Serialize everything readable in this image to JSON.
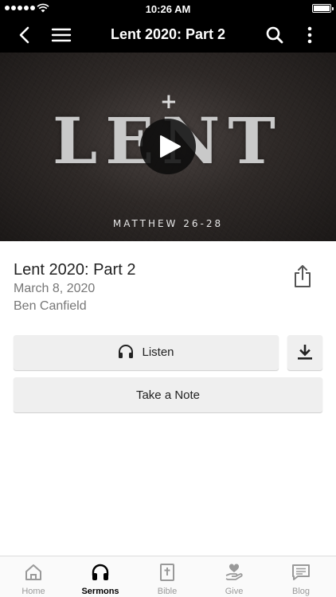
{
  "status_bar": {
    "time": "10:26 AM"
  },
  "nav": {
    "title": "Lent 2020: Part 2"
  },
  "hero": {
    "cross": "+",
    "word": "LENT",
    "subtitle": "MATTHEW 26-28"
  },
  "sermon": {
    "title": "Lent 2020: Part 2",
    "date": "March 8, 2020",
    "speaker": "Ben Canfield"
  },
  "actions": {
    "listen_label": "Listen",
    "note_label": "Take a Note"
  },
  "tabs": [
    {
      "label": "Home",
      "icon": "home-icon",
      "active": false
    },
    {
      "label": "Sermons",
      "icon": "headphones-icon",
      "active": true
    },
    {
      "label": "Bible",
      "icon": "bible-icon",
      "active": false
    },
    {
      "label": "Give",
      "icon": "give-icon",
      "active": false
    },
    {
      "label": "Blog",
      "icon": "blog-icon",
      "active": false
    }
  ],
  "colors": {
    "bar": "#000000",
    "tab_inactive": "#999999",
    "tab_active": "#000000",
    "button_bg": "#efefef"
  }
}
